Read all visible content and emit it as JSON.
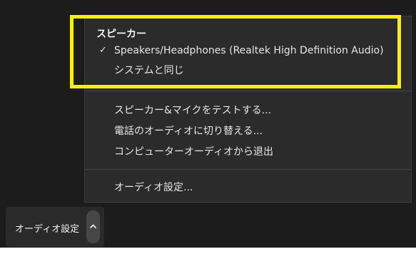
{
  "menu": {
    "speaker_section_title": "スピーカー",
    "speaker_options": [
      {
        "label": "Speakers/Headphones (Realtek High Definition Audio)",
        "checked": true
      },
      {
        "label": "システムと同じ",
        "checked": false
      }
    ],
    "actions": [
      {
        "label": "スピーカー&マイクをテストする..."
      },
      {
        "label": "電話のオーディオに切り替える..."
      },
      {
        "label": "コンピューターオーディオから退出"
      }
    ],
    "settings_label": "オーディオ設定..."
  },
  "bottom_bar": {
    "audio_settings_label": "オーディオ設定"
  },
  "colors": {
    "highlight": "#f4f00a",
    "menu_bg": "#2b2b2b",
    "app_bg": "#1c1c1c"
  },
  "icons": {
    "check": "check-icon",
    "caret": "chevron-up-icon"
  }
}
